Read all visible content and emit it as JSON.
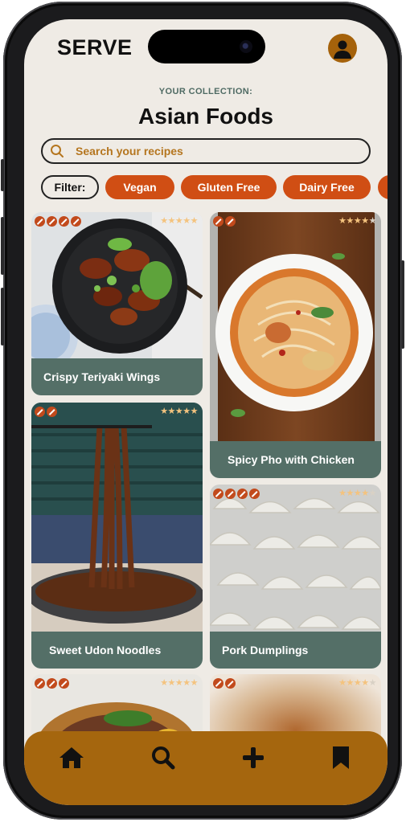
{
  "app": {
    "logo": "SERVE"
  },
  "header": {
    "subtitle": "YOUR COLLECTION:",
    "title": "Asian Foods"
  },
  "search": {
    "placeholder": "Search your recipes"
  },
  "filters": {
    "label": "Filter:",
    "tags": [
      "Vegan",
      "Gluten Free",
      "Dairy Free"
    ]
  },
  "recipes": [
    {
      "name": "Crispy Teriyaki Wings",
      "rating": 5,
      "dietary_badge_count": 4
    },
    {
      "name": "Spicy Pho with Chicken",
      "rating": 4,
      "dietary_badge_count": 2
    },
    {
      "name": "Sweet Udon Noodles",
      "rating": 5,
      "dietary_badge_count": 2
    },
    {
      "name": "Pork Dumplings",
      "rating": 4,
      "dietary_badge_count": 4
    },
    {
      "name": "",
      "rating": 5,
      "dietary_badge_count": 3
    },
    {
      "name": "",
      "rating": 4,
      "dietary_badge_count": 2
    }
  ],
  "nav": {
    "items": [
      "home-icon",
      "search-icon",
      "plus-icon",
      "bookmark-icon"
    ]
  },
  "colors": {
    "background": "#efebe5",
    "accent": "#d04e14",
    "caption": "#546f67",
    "navbar": "#a5660e",
    "star": "#f4c37e"
  }
}
